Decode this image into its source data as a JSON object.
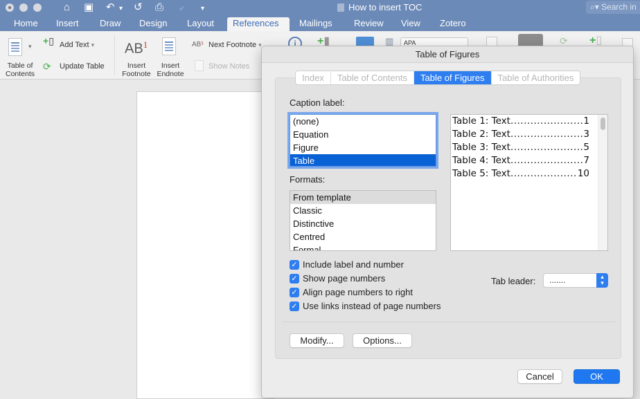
{
  "window": {
    "title": "How to insert TOC",
    "search_placeholder": "Search in Document",
    "search_visible": "Search in"
  },
  "quick_access": {
    "home_icon": "⌂",
    "save_icon": "▣",
    "undo_icon": "↶",
    "undo_dropdown": "▾",
    "redo_icon": "↺",
    "print_icon": "⎙",
    "customize_icon": "▾"
  },
  "tabs": [
    {
      "label": "Home"
    },
    {
      "label": "Insert"
    },
    {
      "label": "Draw"
    },
    {
      "label": "Design"
    },
    {
      "label": "Layout"
    },
    {
      "label": "References",
      "active": true
    },
    {
      "label": "Mailings"
    },
    {
      "label": "Review"
    },
    {
      "label": "View"
    },
    {
      "label": "Zotero"
    }
  ],
  "ribbon": {
    "toc_label_line1": "Table of",
    "toc_label_line2": "Contents",
    "add_text": "Add Text",
    "update_table": "Update Table",
    "insert_footnote_line1": "Insert",
    "insert_footnote_line2": "Footnote",
    "insert_endnote_line1": "Insert",
    "insert_endnote_line2": "Endnote",
    "next_footnote": "Next Footnote",
    "show_notes": "Show Notes",
    "citation_style": "APA",
    "ab_text": "AB",
    "ab_sup": "1",
    "dropdown_caret": "▾"
  },
  "dialog": {
    "title": "Table of Figures",
    "tabs": [
      {
        "label": "Index"
      },
      {
        "label": "Table of Contents"
      },
      {
        "label": "Table of Figures",
        "active": true
      },
      {
        "label": "Table of Authorities"
      }
    ],
    "caption_label_heading": "Caption label:",
    "caption_labels": [
      "(none)",
      "Equation",
      "Figure",
      "Table"
    ],
    "caption_selected": "Table",
    "formats_heading": "Formats:",
    "formats": [
      "From template",
      "Classic",
      "Distinctive",
      "Centred",
      "Formal"
    ],
    "format_selected": "From template",
    "preview": [
      {
        "title": "Table 1: Text",
        "page": "1"
      },
      {
        "title": "Table 2: Text",
        "page": "3"
      },
      {
        "title": "Table 3: Text",
        "page": "5"
      },
      {
        "title": "Table 4: Text",
        "page": "7"
      },
      {
        "title": "Table 5: Text",
        "page": "10"
      }
    ],
    "checkboxes": [
      {
        "label": "Include label and number",
        "checked": true
      },
      {
        "label": "Show page numbers",
        "checked": true
      },
      {
        "label": "Align page numbers to right",
        "checked": true
      },
      {
        "label": "Use links instead of page numbers",
        "checked": true
      }
    ],
    "check_glyph": "✓",
    "tab_leader_label": "Tab leader:",
    "tab_leader_value": ".......",
    "modify_button": "Modify...",
    "options_button": "Options...",
    "cancel_button": "Cancel",
    "ok_button": "OK"
  },
  "colors": {
    "titlebar": "#6c8ab8",
    "accent": "#2f7ef0",
    "selection": "#0961d6"
  }
}
